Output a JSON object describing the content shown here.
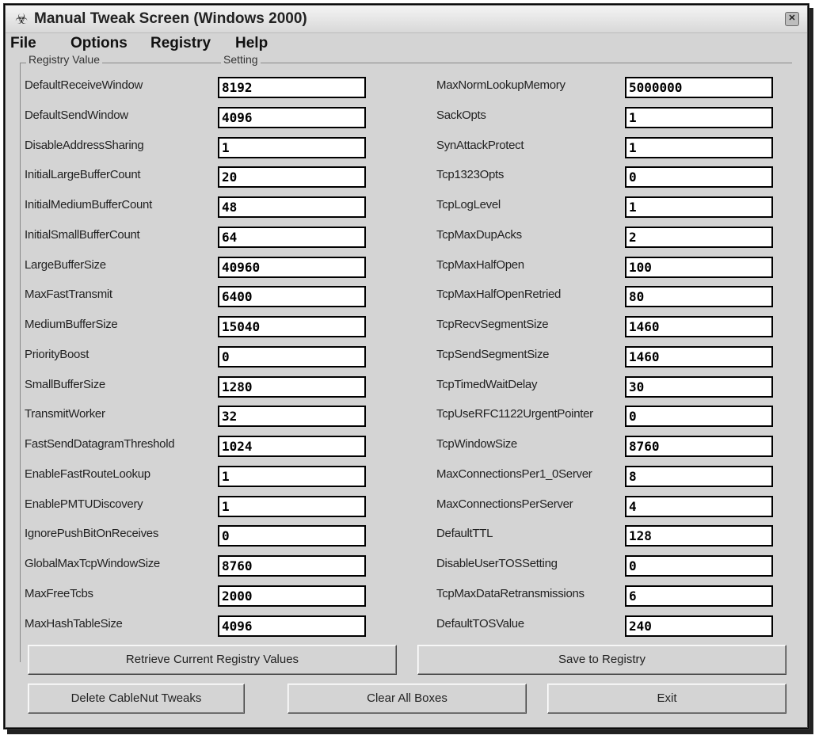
{
  "window": {
    "title": "Manual Tweak Screen (Windows 2000)",
    "icon": "app-icon",
    "close_glyph": "✕"
  },
  "menu": [
    "File",
    "Options",
    "Registry",
    "Help"
  ],
  "group": {
    "registry_value_label": "Registry Value",
    "setting_label": "Setting"
  },
  "left_fields": [
    {
      "label": "DefaultReceiveWindow",
      "value": "8192"
    },
    {
      "label": "DefaultSendWindow",
      "value": "4096"
    },
    {
      "label": "DisableAddressSharing",
      "value": "1"
    },
    {
      "label": "InitialLargeBufferCount",
      "value": "20"
    },
    {
      "label": "InitialMediumBufferCount",
      "value": "48"
    },
    {
      "label": "InitialSmallBufferCount",
      "value": "64"
    },
    {
      "label": "LargeBufferSize",
      "value": "40960"
    },
    {
      "label": "MaxFastTransmit",
      "value": "6400"
    },
    {
      "label": "MediumBufferSize",
      "value": "15040"
    },
    {
      "label": "PriorityBoost",
      "value": "0"
    },
    {
      "label": "SmallBufferSize",
      "value": "1280"
    },
    {
      "label": "TransmitWorker",
      "value": "32"
    },
    {
      "label": "FastSendDatagramThreshold",
      "value": "1024"
    },
    {
      "label": "EnableFastRouteLookup",
      "value": "1"
    },
    {
      "label": "EnablePMTUDiscovery",
      "value": "1"
    },
    {
      "label": "IgnorePushBitOnReceives",
      "value": "0"
    },
    {
      "label": "GlobalMaxTcpWindowSize",
      "value": "8760"
    },
    {
      "label": "MaxFreeTcbs",
      "value": "2000"
    },
    {
      "label": "MaxHashTableSize",
      "value": "4096"
    }
  ],
  "right_fields": [
    {
      "label": "MaxNormLookupMemory",
      "value": "5000000"
    },
    {
      "label": "SackOpts",
      "value": "1"
    },
    {
      "label": "SynAttackProtect",
      "value": "1"
    },
    {
      "label": "Tcp1323Opts",
      "value": "0"
    },
    {
      "label": "TcpLogLevel",
      "value": "1"
    },
    {
      "label": "TcpMaxDupAcks",
      "value": "2"
    },
    {
      "label": "TcpMaxHalfOpen",
      "value": "100"
    },
    {
      "label": "TcpMaxHalfOpenRetried",
      "value": "80"
    },
    {
      "label": "TcpRecvSegmentSize",
      "value": "1460"
    },
    {
      "label": "TcpSendSegmentSize",
      "value": "1460"
    },
    {
      "label": "TcpTimedWaitDelay",
      "value": "30"
    },
    {
      "label": "TcpUseRFC1122UrgentPointer",
      "value": "0"
    },
    {
      "label": "TcpWindowSize",
      "value": "8760"
    },
    {
      "label": "MaxConnectionsPer1_0Server",
      "value": "8"
    },
    {
      "label": "MaxConnectionsPerServer",
      "value": "4"
    },
    {
      "label": "DefaultTTL",
      "value": "128"
    },
    {
      "label": "DisableUserTOSSetting",
      "value": "0"
    },
    {
      "label": "TcpMaxDataRetransmissions",
      "value": "6"
    },
    {
      "label": "DefaultTOSValue",
      "value": "240"
    }
  ],
  "buttons": {
    "retrieve": "Retrieve Current Registry Values",
    "save": "Save to Registry",
    "delete": "Delete CableNut Tweaks",
    "clear": "Clear All Boxes",
    "exit": "Exit"
  }
}
